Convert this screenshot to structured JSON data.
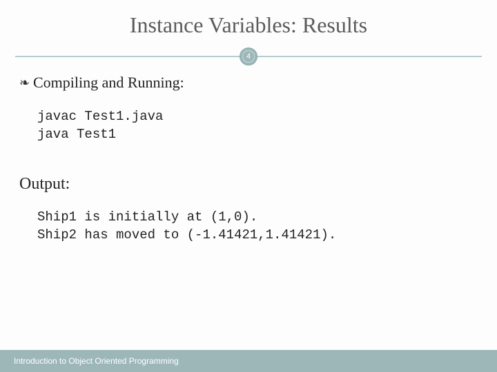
{
  "slide": {
    "title": "Instance Variables: Results",
    "page_number": "4",
    "bullet_label": "Compiling and Running:",
    "code_block_1": "javac Test1.java\njava Test1",
    "output_heading": "Output:",
    "code_block_2": "Ship1 is initially at (1,0).\nShip2 has moved to (-1.41421,1.41421).",
    "footer": "Introduction to Object Oriented Programming"
  },
  "colors": {
    "accent": "#9db7b9",
    "rule": "#b7ccce"
  }
}
